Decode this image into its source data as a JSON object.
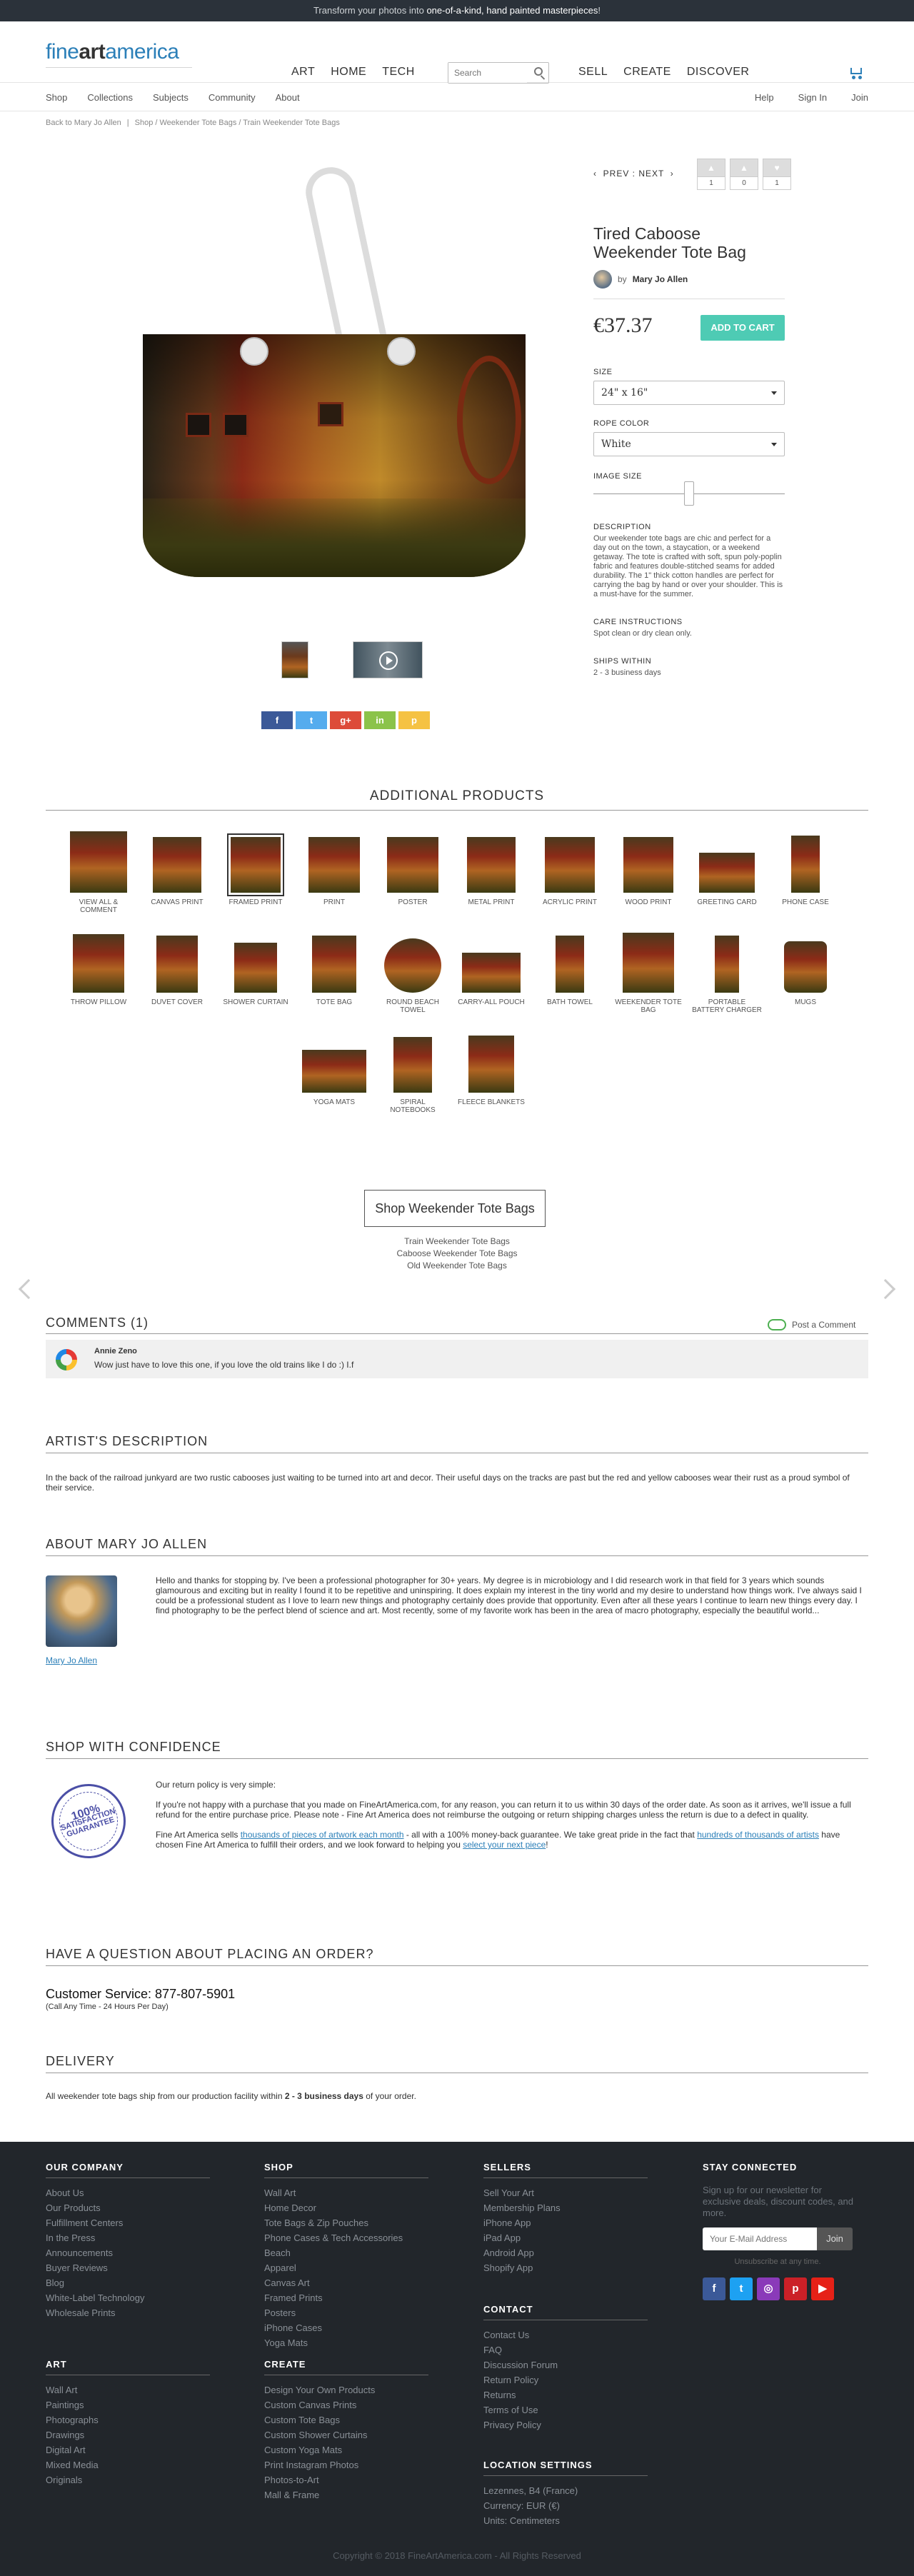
{
  "promo": {
    "pre": "Transform your photos into ",
    "bold": "one-of-a-kind, hand painted masterpieces",
    "post": "!"
  },
  "header": {
    "logo_a": "fine",
    "logo_b": "art",
    "logo_c": "america",
    "nav_left": [
      "ART",
      "HOME",
      "TECH"
    ],
    "search_placeholder": "Search",
    "nav_right": [
      "SELL",
      "CREATE",
      "DISCOVER"
    ]
  },
  "subnav": {
    "left": [
      "Shop",
      "Collections",
      "Subjects",
      "Community",
      "About"
    ],
    "right": [
      "Help",
      "Sign In",
      "Join"
    ]
  },
  "breadcrumb": {
    "back_pre": "Back to ",
    "back_name": "Mary Jo Allen",
    "path": "Shop / Weekender Tote Bags / Train Weekender Tote Bags"
  },
  "product": {
    "prev_next": "PREV : NEXT",
    "counters": [
      "1",
      "0",
      "1"
    ],
    "title": "Tired Caboose Weekender Tote Bag",
    "by": "by",
    "artist": "Mary Jo Allen",
    "price": "€37.37",
    "add_to_cart": "ADD TO CART",
    "size_label": "SIZE",
    "size_value": "24\" x 16\"",
    "rope_label": "ROPE COLOR",
    "rope_value": "White",
    "image_size_label": "IMAGE SIZE",
    "image_size": 0.5,
    "description_label": "DESCRIPTION",
    "description": "Our weekender tote bags are chic and perfect for a day out on the town, a staycation, or a weekend getaway.  The tote is crafted with soft, spun poly-poplin fabric and features double-stitched seams for added durability.  The 1\" thick cotton handles are perfect for carrying the bag by hand or over your shoulder.  This is a must-have for the summer.",
    "care_label": "CARE INSTRUCTIONS",
    "care": "Spot clean or dry clean only.",
    "ships_label": "SHIPS WITHIN",
    "ships": "2 - 3 business days"
  },
  "share": [
    {
      "label": "f",
      "color": "#3b5998"
    },
    {
      "label": "t",
      "color": "#55acee"
    },
    {
      "label": "g+",
      "color": "#dd4b39"
    },
    {
      "label": "in",
      "color": "#8bc34a"
    },
    {
      "label": "p",
      "color": "#f5c243"
    }
  ],
  "additional": {
    "title": "ADDITIONAL PRODUCTS",
    "items": [
      "VIEW ALL & COMMENT",
      "CANVAS PRINT",
      "FRAMED PRINT",
      "PRINT",
      "POSTER",
      "METAL PRINT",
      "ACRYLIC PRINT",
      "WOOD PRINT",
      "GREETING CARD",
      "PHONE CASE",
      "THROW PILLOW",
      "DUVET COVER",
      "SHOWER CURTAIN",
      "TOTE BAG",
      "ROUND BEACH TOWEL",
      "CARRY-ALL POUCH",
      "BATH TOWEL",
      "WEEKENDER TOTE BAG",
      "PORTABLE BATTERY CHARGER",
      "MUGS",
      "YOGA MATS",
      "SPIRAL NOTEBOOKS",
      "FLEECE BLANKETS"
    ]
  },
  "shop_button": "Shop Weekender Tote Bags",
  "shop_links": [
    "Train Weekender Tote Bags",
    "Caboose Weekender Tote Bags",
    "Old Weekender Tote Bags"
  ],
  "comments": {
    "title": "COMMENTS  (1)",
    "post": "Post a Comment",
    "author": "Annie Zeno",
    "text": "Wow just have to love this one, if you love the old trains like I do :) I.f"
  },
  "artist_desc": {
    "title": "ARTIST'S DESCRIPTION",
    "text": "In the back of the railroad junkyard are two rustic cabooses just waiting to be turned into art and decor. Their useful days on the tracks are past but the red and yellow cabooses wear their rust as a proud symbol of their service."
  },
  "about": {
    "title": "ABOUT MARY JO ALLEN",
    "name": "Mary Jo Allen",
    "text": "Hello and thanks for stopping by. I've been a professional photographer for 30+ years. My degree is in microbiology and I did research work in that field for 3 years which sounds glamourous and exciting but in reality I found it to be repetitive and uninspiring. It does explain my interest in the tiny world and my desire to understand how things work. I've always said I could be a professional student as I love to learn new things and photography certainly does provide that opportunity. Even after all these years I continue to learn new things every day. I find photography to be the perfect blend of science and art. Most recently, some of my favorite work has been in the area of macro photography, especially the beautiful world..."
  },
  "confidence": {
    "title": "SHOP WITH CONFIDENCE",
    "seal_top": "100%",
    "seal_mid": "SATISFACTION",
    "seal_bottom": "GUARANTEE",
    "p1": "Our return policy is very simple:",
    "p2": "If you're not happy with a purchase that you made on FineArtAmerica.com, for any reason, you can return it to us within 30 days of the order date.  As soon as it arrives, we'll issue a full refund for the entire purchase price.  Please note - Fine Art America does not reimburse the outgoing or return shipping charges unless the return is due to a defect in quality.",
    "p3a": "Fine Art America sells ",
    "p3link1": "thousands of pieces of artwork each month",
    "p3b": " - all with a 100% money-back guarantee.   We take great pride in the fact that ",
    "p3link2": "hundreds of thousands of artists",
    "p3c": " have chosen Fine Art America to fulfill their orders, and we look forward to helping you ",
    "p3link3": "select your next piece",
    "p3d": "!"
  },
  "question": {
    "title": "HAVE A QUESTION ABOUT PLACING AN ORDER?",
    "phone": "Customer Service: 877-807-5901",
    "hours": "(Call Any Time - 24 Hours Per Day)"
  },
  "delivery": {
    "title": "DELIVERY",
    "pre": "All weekender tote bags ship from our production facility within ",
    "bold": "2 - 3 business days",
    "post": " of your order."
  },
  "footer": {
    "company": {
      "title": "OUR COMPANY",
      "links": [
        "About Us",
        "Our Products",
        "Fulfillment Centers",
        "In the Press",
        "Announcements",
        "Buyer Reviews",
        "Blog",
        "White-Label Technology",
        "Wholesale Prints"
      ]
    },
    "art": {
      "title": "ART",
      "links": [
        "Wall Art",
        "Paintings",
        "Photographs",
        "Drawings",
        "Digital Art",
        "Mixed Media",
        "Originals"
      ]
    },
    "shop": {
      "title": "SHOP",
      "links": [
        "Wall Art",
        "Home Decor",
        "Tote Bags & Zip Pouches",
        "Phone Cases & Tech Accessories",
        "Beach",
        "Apparel",
        "Canvas Art",
        "Framed Prints",
        "Posters",
        "iPhone Cases",
        "Yoga Mats"
      ]
    },
    "create": {
      "title": "CREATE",
      "links": [
        "Design Your Own Products",
        "Custom Canvas Prints",
        "Custom Tote Bags",
        "Custom Shower Curtains",
        "Custom Yoga Mats",
        "Print Instagram Photos",
        "Photos-to-Art",
        "Mall & Frame"
      ]
    },
    "sellers": {
      "title": "SELLERS",
      "links": [
        "Sell Your Art",
        "Membership Plans",
        "iPhone App",
        "iPad App",
        "Android App",
        "Shopify App"
      ]
    },
    "contact": {
      "title": "CONTACT",
      "links": [
        "Contact Us",
        "FAQ",
        "Discussion Forum",
        "Return Policy",
        "Returns",
        "Terms of Use",
        "Privacy Policy"
      ]
    },
    "location": {
      "title": "LOCATION SETTINGS",
      "links": [
        "Lezennes, B4 (France)",
        "Currency: EUR (€)",
        "Units: Centimeters"
      ]
    },
    "connect": {
      "title": "STAY CONNECTED",
      "text": "Sign up for our newsletter for exclusive deals, discount codes, and more.",
      "placeholder": "Your E-Mail Address",
      "join": "Join",
      "unsubscribe": "Unsubscribe at any time.",
      "socials": [
        {
          "label": "f",
          "color": "#3b5998"
        },
        {
          "label": "t",
          "color": "#1da1f2"
        },
        {
          "label": "◎",
          "color": "#8a3ab9"
        },
        {
          "label": "p",
          "color": "#cb2027"
        },
        {
          "label": "▶",
          "color": "#e62117"
        }
      ]
    },
    "copyright": "Copyright © 2018 FineArtAmerica.com - All Rights Reserved"
  }
}
